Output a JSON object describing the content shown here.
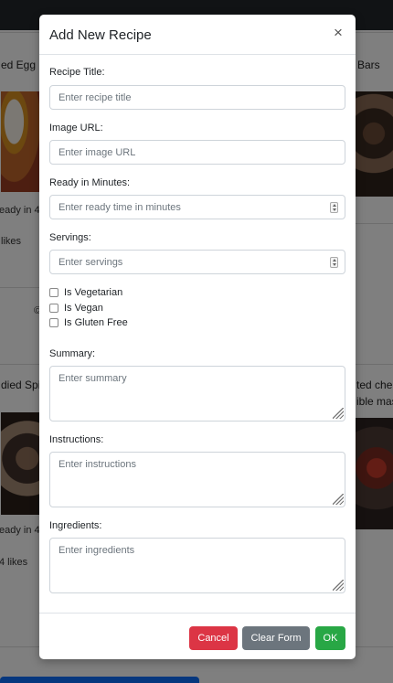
{
  "background": {
    "cards": [
      {
        "title_fragment": "ed Egg C",
        "ready_fragment": "eady in 4",
        "likes_fragment": "likes"
      },
      {
        "title_fragment": "Bars"
      },
      {
        "title_fragment": "died Spic",
        "ready_fragment": "eady in 4",
        "likes_fragment": "4 likes"
      },
      {
        "title_fragment": "ted che",
        "title_fragment_2": "ible mas"
      }
    ],
    "footer_fragment": "©"
  },
  "modal": {
    "title": "Add New Recipe",
    "close_glyph": "×",
    "fields": {
      "title": {
        "label": "Recipe Title:",
        "placeholder": "Enter recipe title"
      },
      "image": {
        "label": "Image URL:",
        "placeholder": "Enter image URL"
      },
      "ready": {
        "label": "Ready in Minutes:",
        "placeholder": "Enter ready time in minutes"
      },
      "servings": {
        "label": "Servings:",
        "placeholder": "Enter servings"
      }
    },
    "checkboxes": [
      {
        "label": "Is Vegetarian",
        "checked": false
      },
      {
        "label": "Is Vegan",
        "checked": false
      },
      {
        "label": "Is Gluten Free",
        "checked": false
      }
    ],
    "textareas": {
      "summary": {
        "label": "Summary:",
        "placeholder": "Enter summary"
      },
      "instructions": {
        "label": "Instructions:",
        "placeholder": "Enter instructions"
      },
      "ingredients": {
        "label": "Ingredients:",
        "placeholder": "Enter ingredients"
      }
    },
    "footer": {
      "cancel": "Cancel",
      "clear": "Clear Form",
      "ok": "OK"
    }
  },
  "colors": {
    "cancel": "#dc3545",
    "clear": "#6c757d",
    "ok": "#28a745",
    "backdrop": "rgba(0,0,0,0.5)"
  }
}
